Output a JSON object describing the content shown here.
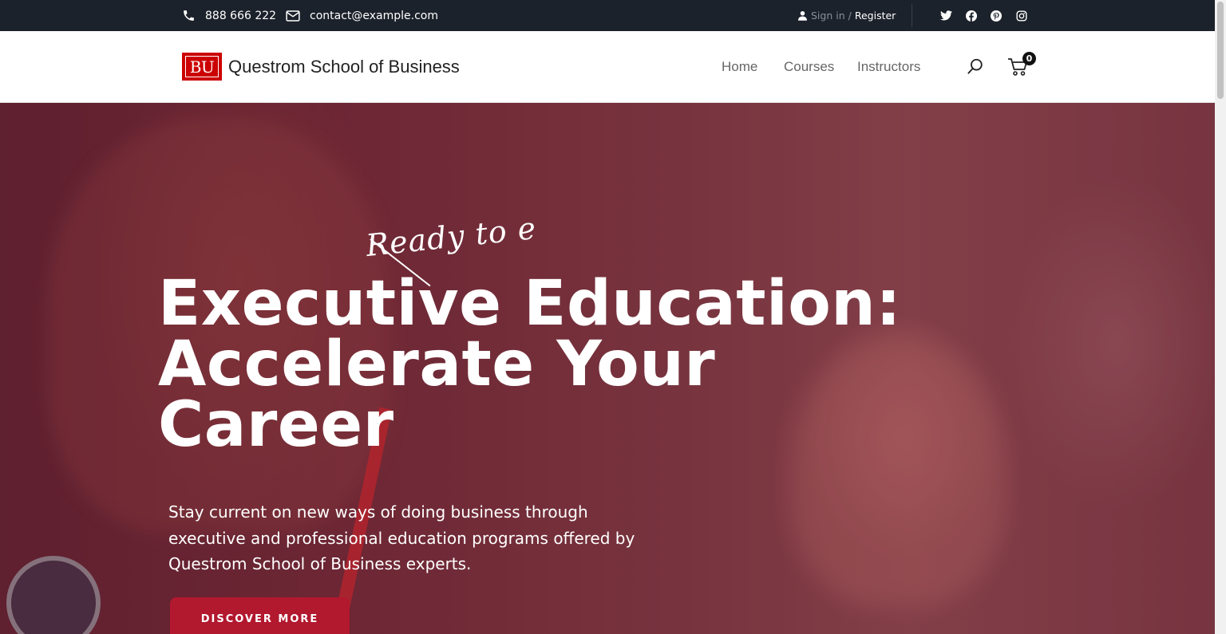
{
  "topbar": {
    "phone": "888 666 222",
    "email": "contact@example.com",
    "signin": "Sign in",
    "separator": "/",
    "register": "Register",
    "social_icons": [
      "twitter-icon",
      "facebook-icon",
      "pinterest-icon",
      "instagram-icon"
    ]
  },
  "header": {
    "logo_mark": "BU",
    "logo_text": "Questrom School of Business",
    "nav": [
      "Home",
      "Courses",
      "Instructors"
    ],
    "cart_count": "0"
  },
  "hero": {
    "script_text": "Ready to e",
    "headline": [
      "Executive Education:",
      "Accelerate Your",
      "Career"
    ],
    "subtext": "Stay current on new ways of doing business through executive and professional education programs offered by Questrom School of Business experts.",
    "cta": "DISCOVER MORE"
  },
  "colors": {
    "topbar_bg": "#1c222b",
    "brand_red": "#cc0000",
    "cta_red": "#b2182e",
    "hero_overlay": "#6e2a38"
  }
}
